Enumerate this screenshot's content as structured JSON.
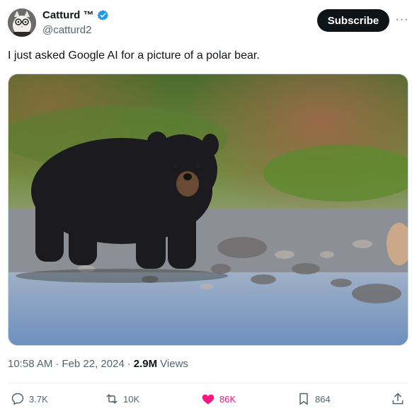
{
  "author": {
    "display_name": "Catturd ™",
    "handle": "@catturd2",
    "verified": true
  },
  "header": {
    "subscribe_label": "Subscribe",
    "more_label": "···"
  },
  "tweet": {
    "text": "I just asked Google AI for a picture of a polar bear."
  },
  "meta": {
    "time": "10:58 AM",
    "separator1": "·",
    "date": "Feb 22, 2024",
    "separator2": "·",
    "views_count": "2.9M",
    "views_label": "Views"
  },
  "actions": {
    "replies": "3.7K",
    "reposts": "10K",
    "likes": "86K",
    "bookmarks": "864"
  },
  "colors": {
    "accent_like": "#f91880",
    "verified_blue": "#1d9bf0",
    "text_primary": "#0f1419",
    "text_secondary": "#536471"
  }
}
